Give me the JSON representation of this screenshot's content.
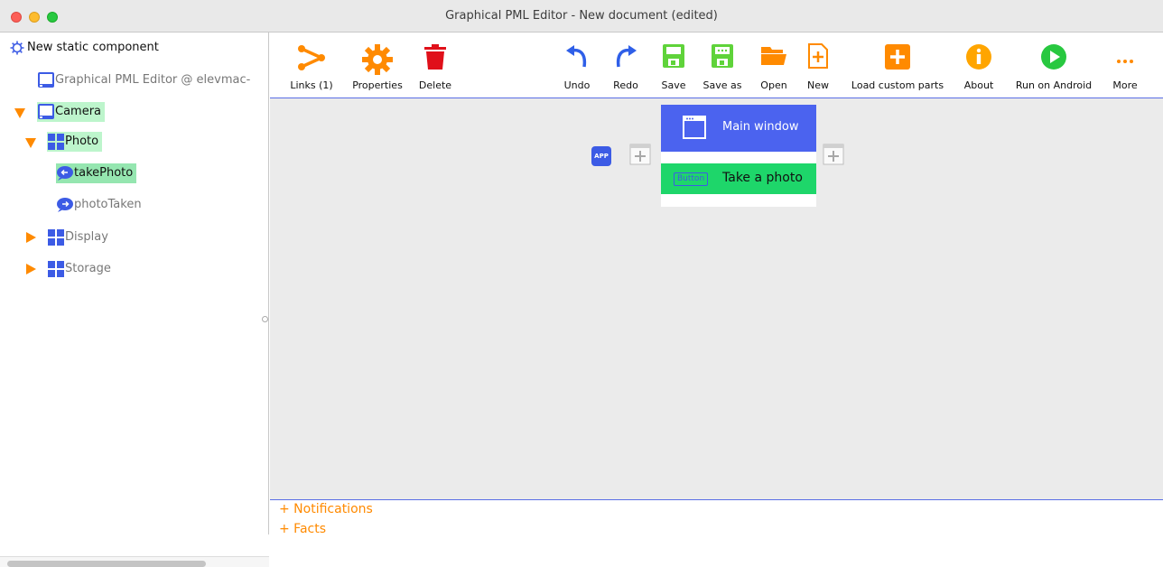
{
  "window": {
    "title": "Graphical PML Editor - New document (edited)"
  },
  "sidebar": {
    "root_label": "New static component",
    "items": [
      {
        "label": "Graphical PML Editor @ elevmac-",
        "icon": "device-icon"
      },
      {
        "label": "Camera",
        "icon": "device-icon",
        "expanded": true
      },
      {
        "label": "Photo",
        "icon": "component-icon",
        "expanded": true
      },
      {
        "label": "takePhoto",
        "icon": "method-icon",
        "selected": true
      },
      {
        "label": "photoTaken",
        "icon": "method-icon"
      },
      {
        "label": "Display",
        "icon": "component-icon",
        "expanded": false
      },
      {
        "label": "Storage",
        "icon": "component-icon",
        "expanded": false
      }
    ]
  },
  "toolbar": {
    "links": "Links (1)",
    "properties": "Properties",
    "delete": "Delete",
    "undo": "Undo",
    "redo": "Redo",
    "save": "Save",
    "save_as": "Save as",
    "open": "Open",
    "new": "New",
    "load_custom_parts": "Load custom parts",
    "about": "About",
    "run_on_android": "Run on Android",
    "more": "More"
  },
  "canvas": {
    "app_badge": "APP",
    "main_window": "Main window",
    "button_badge": "Button",
    "button_label": "Take a photo"
  },
  "bottom": {
    "notifications": "+ Notifications",
    "facts": "+ Facts"
  },
  "colors": {
    "accent_orange": "#ff8a00",
    "accent_blue": "#4b63ef",
    "accent_green": "#1ed66a",
    "delete_red": "#e0101a"
  }
}
